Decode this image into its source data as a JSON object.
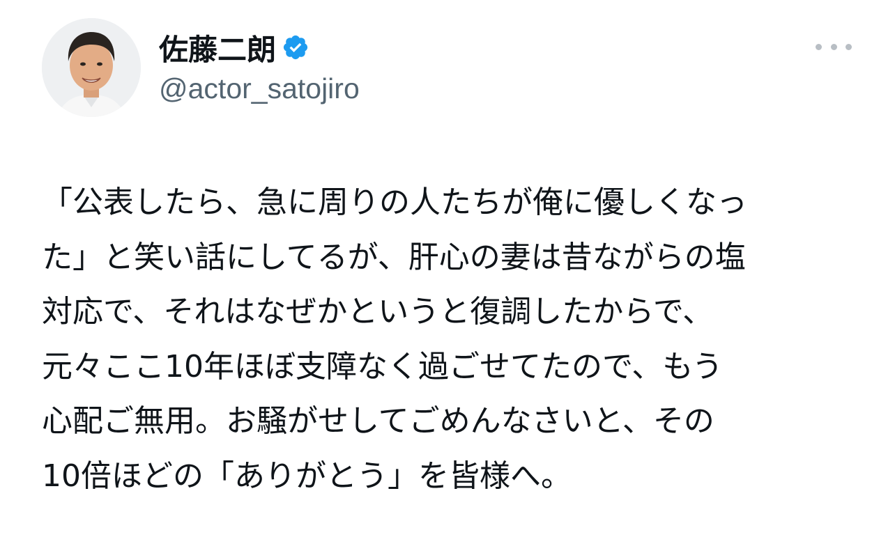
{
  "tweet": {
    "author": {
      "display_name": "佐藤二朗",
      "handle": "@actor_satojiro",
      "verified_icon": "verified-badge-icon",
      "avatar": "avatar-photo"
    },
    "more_icon": "more-options-icon",
    "body_lines": [
      "「公表したら、急に周りの人たちが俺に優しくなっ",
      "た」と笑い話にしてるが、肝心の妻は昔ながらの塩",
      "対応で、それはなぜかというと復調したからで、",
      "元々ここ10年ほぼ支障なく過ごせてたので、もう",
      "心配ご無用。お騒がせしてごめんなさいと、その",
      "10倍ほどの「ありがとう」を皆様へ。"
    ]
  },
  "colors": {
    "text_primary": "#0f1419",
    "text_secondary": "#536471",
    "verified_blue": "#1d9bf0",
    "more_dots": "#b8bec4",
    "background": "#ffffff"
  }
}
